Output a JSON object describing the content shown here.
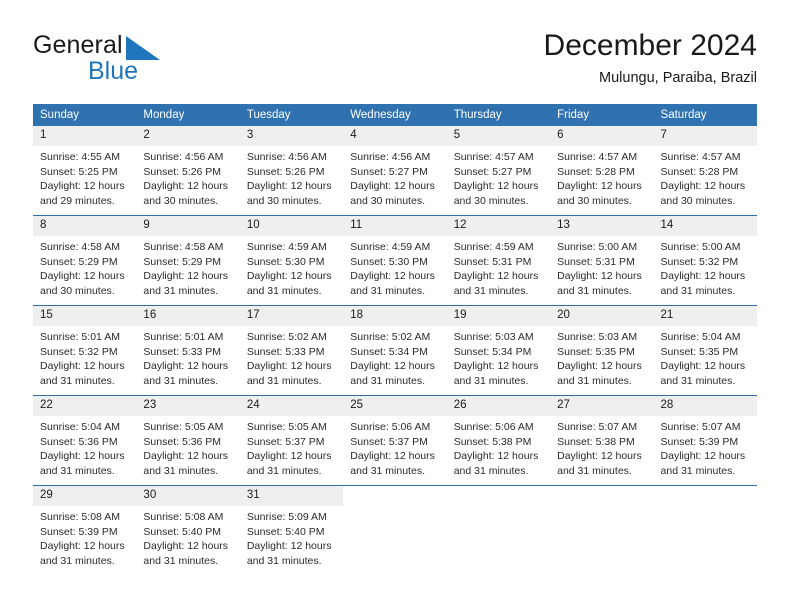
{
  "brand": {
    "name_part1": "General",
    "name_part2": "Blue",
    "logo_icon": "blue-triangle-flag-icon",
    "accent_color": "#1f76bd"
  },
  "header": {
    "title": "December 2024",
    "subtitle": "Mulungu, Paraiba, Brazil"
  },
  "calendar": {
    "header_bg": "#3071b0",
    "daynum_bg": "#efefef",
    "row_divider": "#2e6da8",
    "weekday_headers": [
      "Sunday",
      "Monday",
      "Tuesday",
      "Wednesday",
      "Thursday",
      "Friday",
      "Saturday"
    ],
    "weeks": [
      [
        {
          "day": "1",
          "sunrise": "Sunrise: 4:55 AM",
          "sunset": "Sunset: 5:25 PM",
          "daylight": "Daylight: 12 hours and 29 minutes."
        },
        {
          "day": "2",
          "sunrise": "Sunrise: 4:56 AM",
          "sunset": "Sunset: 5:26 PM",
          "daylight": "Daylight: 12 hours and 30 minutes."
        },
        {
          "day": "3",
          "sunrise": "Sunrise: 4:56 AM",
          "sunset": "Sunset: 5:26 PM",
          "daylight": "Daylight: 12 hours and 30 minutes."
        },
        {
          "day": "4",
          "sunrise": "Sunrise: 4:56 AM",
          "sunset": "Sunset: 5:27 PM",
          "daylight": "Daylight: 12 hours and 30 minutes."
        },
        {
          "day": "5",
          "sunrise": "Sunrise: 4:57 AM",
          "sunset": "Sunset: 5:27 PM",
          "daylight": "Daylight: 12 hours and 30 minutes."
        },
        {
          "day": "6",
          "sunrise": "Sunrise: 4:57 AM",
          "sunset": "Sunset: 5:28 PM",
          "daylight": "Daylight: 12 hours and 30 minutes."
        },
        {
          "day": "7",
          "sunrise": "Sunrise: 4:57 AM",
          "sunset": "Sunset: 5:28 PM",
          "daylight": "Daylight: 12 hours and 30 minutes."
        }
      ],
      [
        {
          "day": "8",
          "sunrise": "Sunrise: 4:58 AM",
          "sunset": "Sunset: 5:29 PM",
          "daylight": "Daylight: 12 hours and 30 minutes."
        },
        {
          "day": "9",
          "sunrise": "Sunrise: 4:58 AM",
          "sunset": "Sunset: 5:29 PM",
          "daylight": "Daylight: 12 hours and 31 minutes."
        },
        {
          "day": "10",
          "sunrise": "Sunrise: 4:59 AM",
          "sunset": "Sunset: 5:30 PM",
          "daylight": "Daylight: 12 hours and 31 minutes."
        },
        {
          "day": "11",
          "sunrise": "Sunrise: 4:59 AM",
          "sunset": "Sunset: 5:30 PM",
          "daylight": "Daylight: 12 hours and 31 minutes."
        },
        {
          "day": "12",
          "sunrise": "Sunrise: 4:59 AM",
          "sunset": "Sunset: 5:31 PM",
          "daylight": "Daylight: 12 hours and 31 minutes."
        },
        {
          "day": "13",
          "sunrise": "Sunrise: 5:00 AM",
          "sunset": "Sunset: 5:31 PM",
          "daylight": "Daylight: 12 hours and 31 minutes."
        },
        {
          "day": "14",
          "sunrise": "Sunrise: 5:00 AM",
          "sunset": "Sunset: 5:32 PM",
          "daylight": "Daylight: 12 hours and 31 minutes."
        }
      ],
      [
        {
          "day": "15",
          "sunrise": "Sunrise: 5:01 AM",
          "sunset": "Sunset: 5:32 PM",
          "daylight": "Daylight: 12 hours and 31 minutes."
        },
        {
          "day": "16",
          "sunrise": "Sunrise: 5:01 AM",
          "sunset": "Sunset: 5:33 PM",
          "daylight": "Daylight: 12 hours and 31 minutes."
        },
        {
          "day": "17",
          "sunrise": "Sunrise: 5:02 AM",
          "sunset": "Sunset: 5:33 PM",
          "daylight": "Daylight: 12 hours and 31 minutes."
        },
        {
          "day": "18",
          "sunrise": "Sunrise: 5:02 AM",
          "sunset": "Sunset: 5:34 PM",
          "daylight": "Daylight: 12 hours and 31 minutes."
        },
        {
          "day": "19",
          "sunrise": "Sunrise: 5:03 AM",
          "sunset": "Sunset: 5:34 PM",
          "daylight": "Daylight: 12 hours and 31 minutes."
        },
        {
          "day": "20",
          "sunrise": "Sunrise: 5:03 AM",
          "sunset": "Sunset: 5:35 PM",
          "daylight": "Daylight: 12 hours and 31 minutes."
        },
        {
          "day": "21",
          "sunrise": "Sunrise: 5:04 AM",
          "sunset": "Sunset: 5:35 PM",
          "daylight": "Daylight: 12 hours and 31 minutes."
        }
      ],
      [
        {
          "day": "22",
          "sunrise": "Sunrise: 5:04 AM",
          "sunset": "Sunset: 5:36 PM",
          "daylight": "Daylight: 12 hours and 31 minutes."
        },
        {
          "day": "23",
          "sunrise": "Sunrise: 5:05 AM",
          "sunset": "Sunset: 5:36 PM",
          "daylight": "Daylight: 12 hours and 31 minutes."
        },
        {
          "day": "24",
          "sunrise": "Sunrise: 5:05 AM",
          "sunset": "Sunset: 5:37 PM",
          "daylight": "Daylight: 12 hours and 31 minutes."
        },
        {
          "day": "25",
          "sunrise": "Sunrise: 5:06 AM",
          "sunset": "Sunset: 5:37 PM",
          "daylight": "Daylight: 12 hours and 31 minutes."
        },
        {
          "day": "26",
          "sunrise": "Sunrise: 5:06 AM",
          "sunset": "Sunset: 5:38 PM",
          "daylight": "Daylight: 12 hours and 31 minutes."
        },
        {
          "day": "27",
          "sunrise": "Sunrise: 5:07 AM",
          "sunset": "Sunset: 5:38 PM",
          "daylight": "Daylight: 12 hours and 31 minutes."
        },
        {
          "day": "28",
          "sunrise": "Sunrise: 5:07 AM",
          "sunset": "Sunset: 5:39 PM",
          "daylight": "Daylight: 12 hours and 31 minutes."
        }
      ],
      [
        {
          "day": "29",
          "sunrise": "Sunrise: 5:08 AM",
          "sunset": "Sunset: 5:39 PM",
          "daylight": "Daylight: 12 hours and 31 minutes."
        },
        {
          "day": "30",
          "sunrise": "Sunrise: 5:08 AM",
          "sunset": "Sunset: 5:40 PM",
          "daylight": "Daylight: 12 hours and 31 minutes."
        },
        {
          "day": "31",
          "sunrise": "Sunrise: 5:09 AM",
          "sunset": "Sunset: 5:40 PM",
          "daylight": "Daylight: 12 hours and 31 minutes."
        },
        {
          "day": "",
          "sunrise": "",
          "sunset": "",
          "daylight": ""
        },
        {
          "day": "",
          "sunrise": "",
          "sunset": "",
          "daylight": ""
        },
        {
          "day": "",
          "sunrise": "",
          "sunset": "",
          "daylight": ""
        },
        {
          "day": "",
          "sunrise": "",
          "sunset": "",
          "daylight": ""
        }
      ]
    ]
  }
}
